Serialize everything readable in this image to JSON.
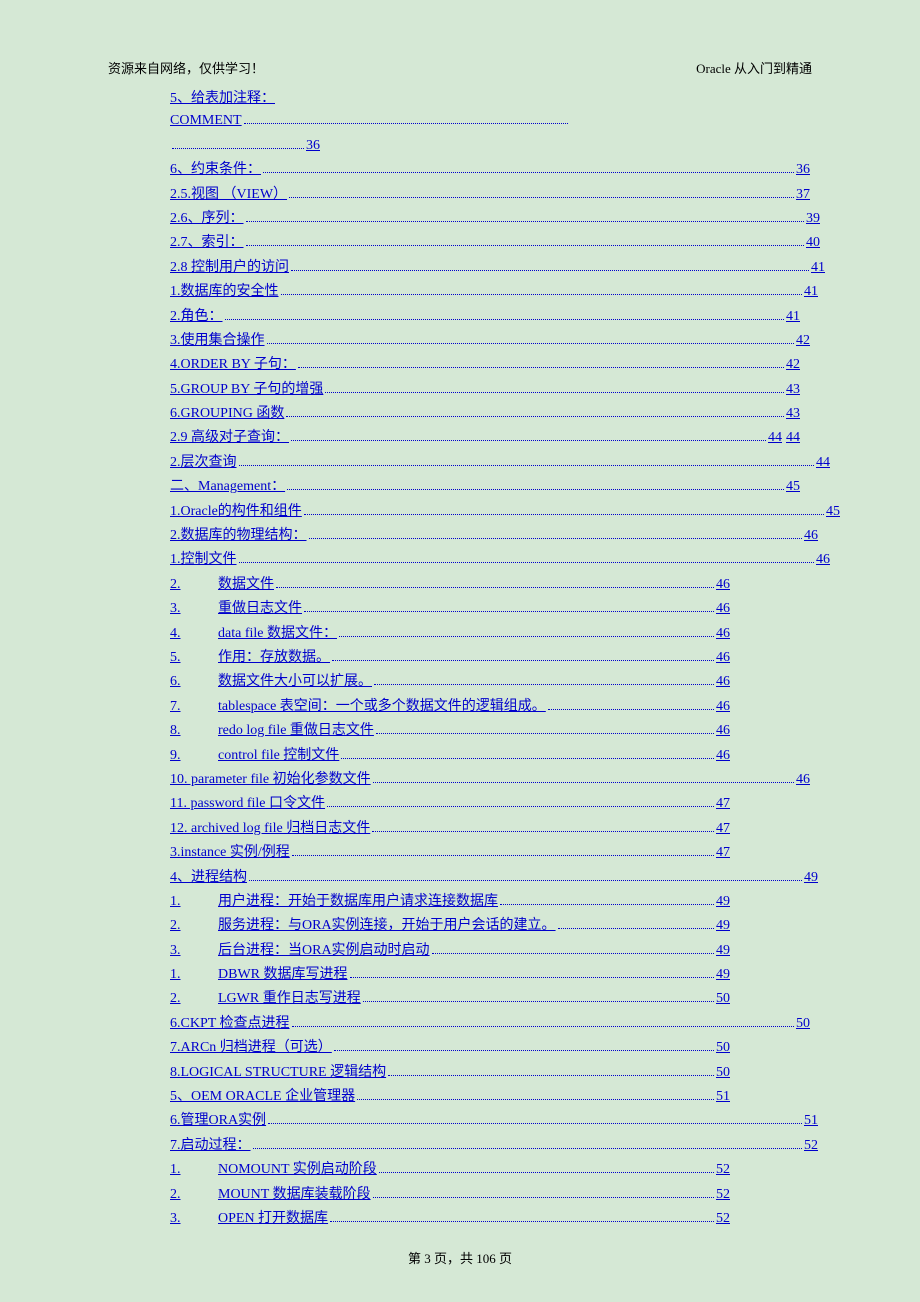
{
  "header": {
    "left": "资源来自网络，仅供学习！",
    "right": "Oracle 从入门到精通"
  },
  "footer": "第 3 页，共 106 页",
  "toc": [
    {
      "type": "multi",
      "line1": "5、给表加注释：",
      "line2": "COMMENT",
      "page": "36"
    },
    {
      "type": "line",
      "text": "6、约束条件：",
      "page": "36"
    },
    {
      "type": "line",
      "text": "2.5.视图 （VIEW）",
      "page": "37"
    },
    {
      "type": "line",
      "text": "2.6、序列：",
      "page": "39"
    },
    {
      "type": "line",
      "text": "2.7、索引：",
      "page": "40"
    },
    {
      "type": "line",
      "text": "2.8 控制用户的访问",
      "page": "41"
    },
    {
      "type": "line",
      "text": "1.数据库的安全性",
      "page": "41"
    },
    {
      "type": "line",
      "text": "2.角色：",
      "page": "41"
    },
    {
      "type": "line",
      "text": "3.使用集合操作",
      "page": "42"
    },
    {
      "type": "line",
      "text": "4.ORDER BY 子句：",
      "page": "42"
    },
    {
      "type": "line",
      "text": "5.GROUP BY 子句的增强",
      "page": "43"
    },
    {
      "type": "line",
      "text": "6.GROUPING 函数",
      "page": "43"
    },
    {
      "type": "line",
      "text": "2.9 高级对子查询：",
      "page": "44",
      "extra": "44"
    },
    {
      "type": "line",
      "text": "2.层次查询",
      "page": "44"
    },
    {
      "type": "line",
      "text": "二、Management：",
      "page": "45"
    },
    {
      "type": "line",
      "text": "1.Oracle的构件和组件",
      "page": "45"
    },
    {
      "type": "line",
      "text": "2.数据库的物理结构：",
      "page": "46"
    },
    {
      "type": "line",
      "text": "1.控制文件",
      "page": "46"
    },
    {
      "type": "num",
      "num": "2.",
      "text": "数据文件",
      "page": "46"
    },
    {
      "type": "num",
      "num": "3.",
      "text": "重做日志文件",
      "page": "46"
    },
    {
      "type": "num",
      "num": "4.",
      "text": "data file 数据文件：",
      "page": "46"
    },
    {
      "type": "num",
      "num": "5.",
      "text": "作用：存放数据。",
      "page": "46"
    },
    {
      "type": "num",
      "num": "6.",
      "text": "数据文件大小可以扩展。",
      "page": "46"
    },
    {
      "type": "num",
      "num": "7.",
      "text": "tablespace 表空间：一个或多个数据文件的逻辑组成。",
      "page": "46"
    },
    {
      "type": "num",
      "num": "8.",
      "text": "redo log file 重做日志文件",
      "page": "46"
    },
    {
      "type": "num",
      "num": "9.",
      "text": "control file 控制文件",
      "page": "46"
    },
    {
      "type": "line",
      "text": "10. parameter file 初始化参数文件",
      "page": "46"
    },
    {
      "type": "line",
      "text": "11. password file 口令文件",
      "page": "47"
    },
    {
      "type": "line",
      "text": "12. archived log file 归档日志文件",
      "page": "47"
    },
    {
      "type": "line",
      "text": "3.instance 实例/例程",
      "page": "47"
    },
    {
      "type": "line",
      "text": "4、进程结构",
      "page": "49"
    },
    {
      "type": "num",
      "num": "1.",
      "text": "用户进程：开始于数据库用户请求连接数据库",
      "page": "49"
    },
    {
      "type": "num",
      "num": "2.",
      "text": "服务进程：与ORA实例连接，开始于用户会话的建立。",
      "page": "49"
    },
    {
      "type": "num",
      "num": "3.",
      "text": "后台进程：当ORA实例启动时启动",
      "page": "49"
    },
    {
      "type": "num",
      "num": "1.",
      "text": "DBWR 数据库写进程",
      "page": "49"
    },
    {
      "type": "num",
      "num": "2.",
      "text": "LGWR 重作日志写进程",
      "page": "50"
    },
    {
      "type": "line",
      "text": "6.CKPT 检查点进程",
      "page": "50"
    },
    {
      "type": "line",
      "text": "7.ARCn 归档进程（可选）",
      "page": "50"
    },
    {
      "type": "line",
      "text": "8.LOGICAL STRUCTURE 逻辑结构",
      "page": "50"
    },
    {
      "type": "line",
      "text": "5、OEM ORACLE 企业管理器",
      "page": "51"
    },
    {
      "type": "line",
      "text": "6.管理ORA实例",
      "page": "51"
    },
    {
      "type": "line",
      "text": "7.启动过程：",
      "page": "52"
    },
    {
      "type": "num",
      "num": "1.",
      "text": "NOMOUNT 实例启动阶段",
      "page": "52"
    },
    {
      "type": "num",
      "num": "2.",
      "text": "MOUNT 数据库装载阶段",
      "page": "52"
    },
    {
      "type": "num",
      "num": "3.",
      "text": "OPEN 打开数据库",
      "page": "52"
    }
  ]
}
